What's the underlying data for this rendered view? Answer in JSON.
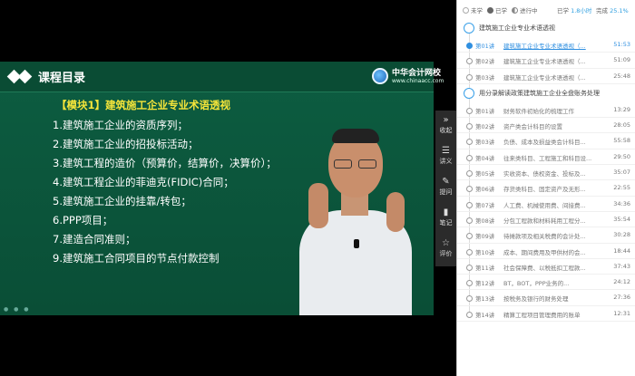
{
  "slide": {
    "title": "课程目录",
    "brand_name": "中华会计网校",
    "brand_url": "www.chinaacc.com",
    "module": "【模块1】建筑施工企业专业术语透视",
    "items": [
      "1.建筑施工企业的资质序列；",
      "2.建筑施工企业的招投标活动；",
      "3.建筑工程的造价（预算价，结算价，决算价）；",
      "4.建筑工程企业的菲迪克(FIDIC)合同；",
      "5.建筑施工企业的挂靠/转包；",
      "6.PPP项目；",
      "7.建造合同准则；",
      "9.建筑施工合同项目的节点付款控制"
    ]
  },
  "toolbar": [
    {
      "icon": "»",
      "label": "收起",
      "icon_name": "collapse-icon"
    },
    {
      "icon": "☰",
      "label": "讲义",
      "icon_name": "handout-icon"
    },
    {
      "icon": "✎",
      "label": "提问",
      "icon_name": "question-icon"
    },
    {
      "icon": "▮",
      "label": "笔记",
      "icon_name": "notes-icon"
    },
    {
      "icon": "☆",
      "label": "评价",
      "icon_name": "star-icon"
    }
  ],
  "panel": {
    "legend": {
      "unstudied": "未学",
      "studied": "已学",
      "in_progress": "进行中",
      "studied_time_label": "已学",
      "studied_time": "1.8小时",
      "completion_label": "完成",
      "completion": "25.1%"
    },
    "sections": [
      {
        "title": "建筑施工企业专业术语透视",
        "lessons": [
          {
            "num": "第01讲",
            "title": "建筑施工企业专业术语透视（...",
            "duration": "51:53",
            "active": true
          },
          {
            "num": "第02讲",
            "title": "建筑施工企业专业术语透视（...",
            "duration": "51:09",
            "active": false
          },
          {
            "num": "第03讲",
            "title": "建筑施工企业专业术语透视（...",
            "duration": "25:48",
            "active": false
          }
        ]
      },
      {
        "title": "用分录解读政策建筑施工企业全盘账务处理",
        "lessons": [
          {
            "num": "第01讲",
            "title": "财务软件初始化的梳理工作",
            "duration": "13:29",
            "active": false
          },
          {
            "num": "第02讲",
            "title": "资产类会计科目的设置",
            "duration": "28:05",
            "active": false
          },
          {
            "num": "第03讲",
            "title": "负债、成本及损益类会计科目...",
            "duration": "55:58",
            "active": false
          },
          {
            "num": "第04讲",
            "title": "往来类科目、工程施工和科目设...",
            "duration": "29:50",
            "active": false
          },
          {
            "num": "第05讲",
            "title": "实收资本、债权资金、投标及...",
            "duration": "35:07",
            "active": false
          },
          {
            "num": "第06讲",
            "title": "存货类科目、固定资产及无形...",
            "duration": "22:55",
            "active": false
          },
          {
            "num": "第07讲",
            "title": "人工费、机械使用费、间接费...",
            "duration": "34:36",
            "active": false
          },
          {
            "num": "第08讲",
            "title": "分包工程款和材料耗用工程分...",
            "duration": "35:54",
            "active": false
          },
          {
            "num": "第09讲",
            "title": "待摊款项及相关税费的会计处...",
            "duration": "30:28",
            "active": false
          },
          {
            "num": "第10讲",
            "title": "成本、期间费用及甲供材的会...",
            "duration": "18:44",
            "active": false
          },
          {
            "num": "第11讲",
            "title": "社会保障费、以税抵扣工程款...",
            "duration": "37:43",
            "active": false
          },
          {
            "num": "第12讲",
            "title": "BT，BOT，PPP业务的...",
            "duration": "24:12",
            "active": false
          },
          {
            "num": "第13讲",
            "title": "按税务及银行的财务处理",
            "duration": "27:36",
            "active": false
          },
          {
            "num": "第14讲",
            "title": "精算工程项目管理费用的账单",
            "duration": "12:31",
            "active": false
          }
        ]
      }
    ]
  },
  "colors": {
    "slide_green": "#0d5d41",
    "module_yellow": "#f5e53a",
    "accent_blue": "#2f8fe0",
    "unstudied_dot": "#c0c0c0",
    "studied_dot": "#666666",
    "in_progress_dot": "#888888"
  }
}
